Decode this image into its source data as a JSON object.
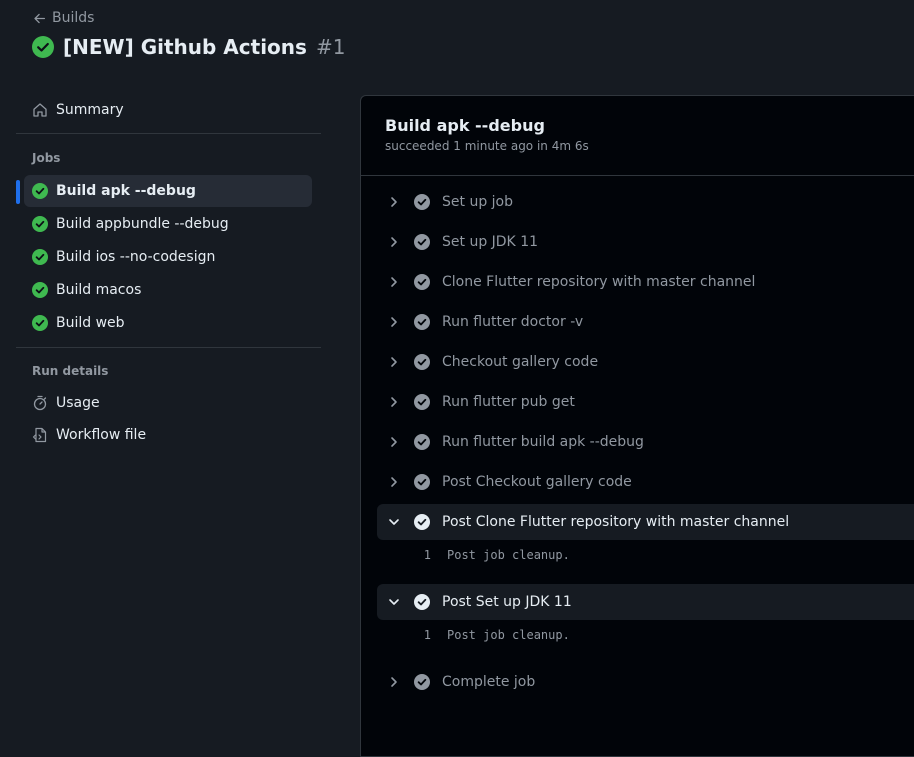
{
  "header": {
    "back_label": "Builds",
    "run_title": "[NEW] Github Actions",
    "run_number": "#1"
  },
  "sidebar": {
    "summary_label": "Summary",
    "jobs_heading": "Jobs",
    "jobs": [
      {
        "label": "Build apk --debug",
        "selected": true
      },
      {
        "label": "Build appbundle --debug"
      },
      {
        "label": "Build ios --no-codesign"
      },
      {
        "label": "Build macos"
      },
      {
        "label": "Build web"
      }
    ],
    "run_details_heading": "Run details",
    "usage_label": "Usage",
    "workflow_file_label": "Workflow file"
  },
  "job": {
    "title": "Build apk --debug",
    "meta": "succeeded 1 minute ago in 4m 6s",
    "steps": [
      {
        "label": "Set up job"
      },
      {
        "label": "Set up JDK 11"
      },
      {
        "label": "Clone Flutter repository with master channel"
      },
      {
        "label": "Run flutter doctor -v"
      },
      {
        "label": "Checkout gallery code"
      },
      {
        "label": "Run flutter pub get"
      },
      {
        "label": "Run flutter build apk --debug"
      },
      {
        "label": "Post Checkout gallery code"
      },
      {
        "label": "Post Clone Flutter repository with master channel",
        "expanded": true,
        "log": [
          {
            "n": "1",
            "text": "Post job cleanup."
          }
        ]
      },
      {
        "label": "Post Set up JDK 11",
        "expanded": true,
        "log": [
          {
            "n": "1",
            "text": "Post job cleanup."
          }
        ]
      },
      {
        "label": "Complete job"
      }
    ]
  },
  "colors": {
    "success": "#3fb950",
    "accent": "#1f6feb",
    "background": "#161b22",
    "panel": "#010409"
  }
}
